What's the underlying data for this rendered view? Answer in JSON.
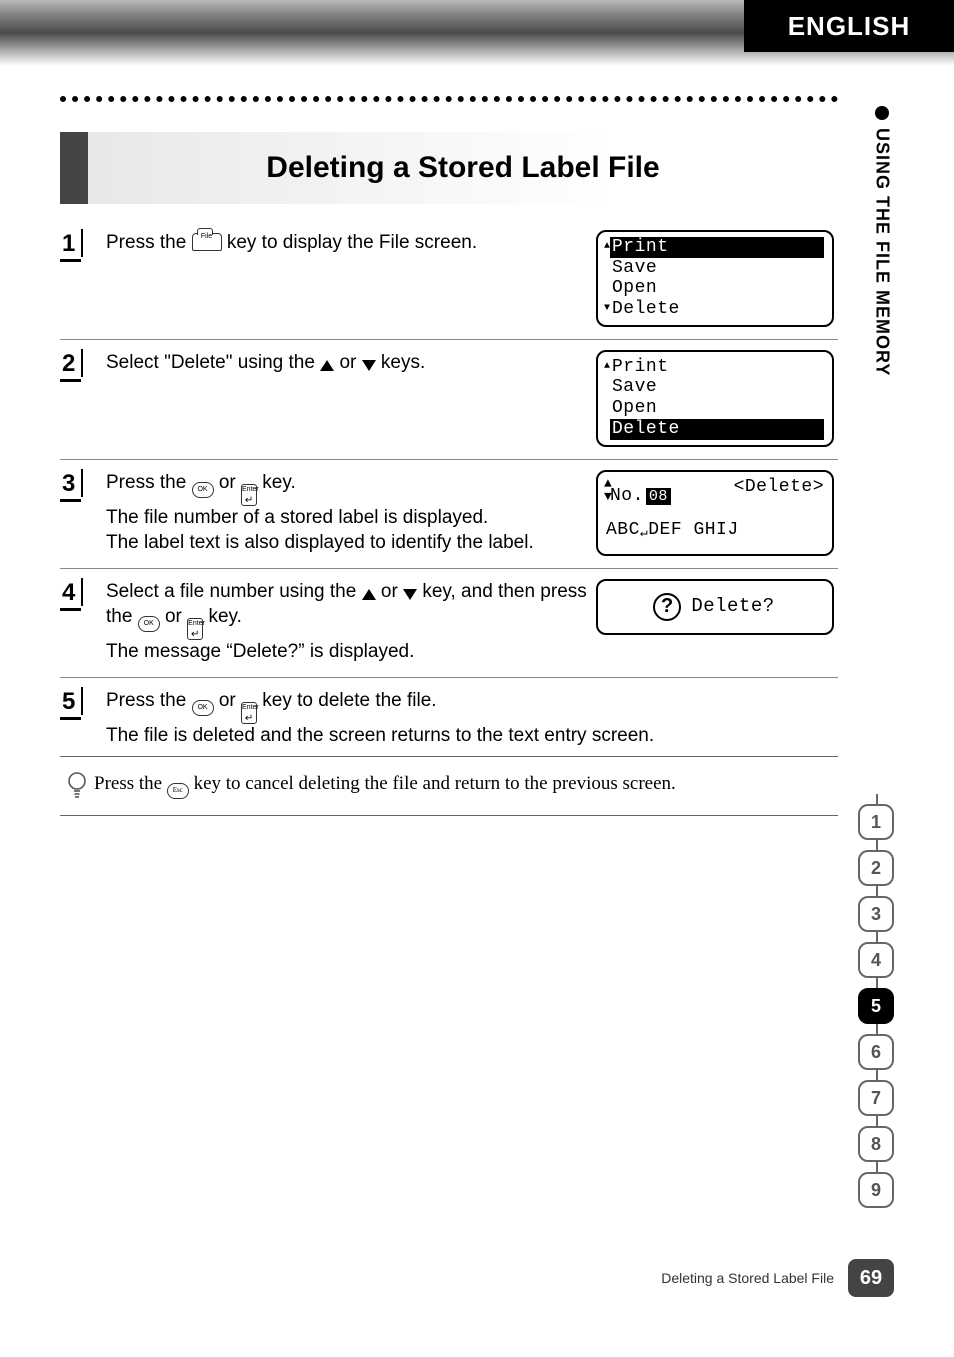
{
  "header": {
    "language": "ENGLISH"
  },
  "sidetab": {
    "label": "USING THE FILE MEMORY"
  },
  "title": "Deleting a Stored Label File",
  "icons": {
    "file_label": "File",
    "ok_label": "OK",
    "enter_label": "Enter",
    "esc_label": "Esc"
  },
  "steps": [
    {
      "num": "1",
      "text_1": "Press the ",
      "text_2": " key to display the File screen.",
      "lcd": {
        "items": [
          "Print",
          "Save",
          "Open",
          "Delete"
        ],
        "selected": 0,
        "scroll_up": true,
        "scroll_down": true
      }
    },
    {
      "num": "2",
      "text_1": "Select \"Delete\" using the ",
      "text_or": " or ",
      "text_2": " keys.",
      "lcd": {
        "items": [
          "Print",
          "Save",
          "Open",
          "Delete"
        ],
        "selected": 3,
        "scroll_up": true,
        "scroll_down": false
      }
    },
    {
      "num": "3",
      "text_1": "Press the ",
      "text_or": " or ",
      "text_key_end": " key.",
      "text_line2": "The file number of a stored label is displayed.",
      "text_line3": "The label text is also displayed to identify the label.",
      "lcd": {
        "no_prefix": "No.",
        "no_value": "08",
        "action": "<Delete>",
        "preview": "ABC",
        "preview2": "DEF GHIJ"
      }
    },
    {
      "num": "4",
      "text_1": "Select a file number using the ",
      "text_or": " or ",
      "text_key_suffix": " key, and then press the ",
      "text_key_end2": " key.",
      "text_line2": "The message “Delete?” is displayed.",
      "lcd": {
        "prompt": "Delete?"
      }
    },
    {
      "num": "5",
      "text_1": "Press the ",
      "text_or": " or ",
      "text_key_end": " key to delete the file.",
      "text_line2": "The file is deleted and the screen returns to the text entry screen."
    }
  ],
  "tip": {
    "text_1": "Press the ",
    "text_2": " key to cancel deleting the file and return to the previous screen."
  },
  "numtabs": {
    "items": [
      "1",
      "2",
      "3",
      "4",
      "5",
      "6",
      "7",
      "8",
      "9"
    ],
    "active": "5"
  },
  "footer": {
    "label": "Deleting a Stored Label File",
    "page": "69"
  }
}
